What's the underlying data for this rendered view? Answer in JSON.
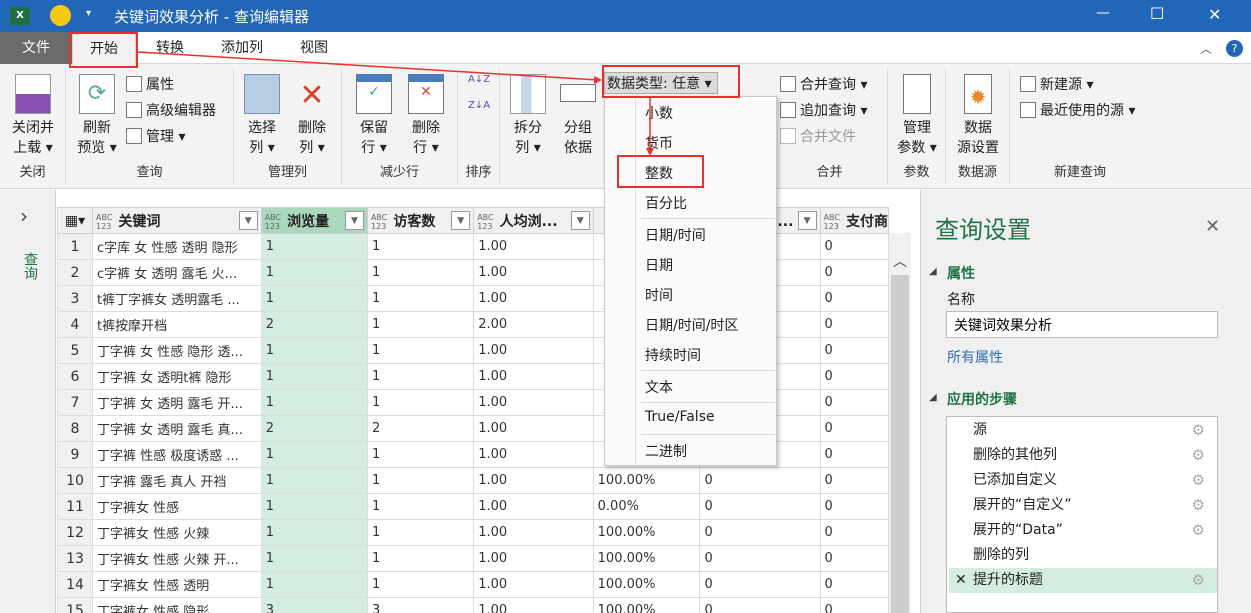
{
  "window": {
    "title": "关键词效果分析 - 查询编辑器",
    "app_icon": "excel-icon",
    "minimize": "—",
    "maximize": "☐",
    "close": "✕"
  },
  "tabs": [
    "文件",
    "开始",
    "转换",
    "添加列",
    "视图"
  ],
  "ribbon": {
    "close": {
      "label1": "关闭并",
      "label2": "上载 ▾",
      "group": "关闭"
    },
    "query": {
      "refresh1": "刷新",
      "refresh2": "预览 ▾",
      "properties": "属性",
      "advanced_editor": "高级编辑器",
      "manage": "管理 ▾",
      "group": "查询"
    },
    "manage_cols": {
      "choose1": "选择",
      "choose2": "列 ▾",
      "remove1": "删除",
      "remove2": "列 ▾",
      "group": "管理列"
    },
    "reduce_rows": {
      "keep1": "保留",
      "keep2": "行 ▾",
      "remove1": "删除",
      "remove2": "行 ▾",
      "group": "减少行"
    },
    "sort": {
      "group": "排序",
      "asc": "A↓Z",
      "desc": "Z↓A"
    },
    "transform": {
      "split1": "拆分",
      "split2": "列 ▾",
      "group1": "分组",
      "group2": "依据",
      "data_type": "数据类型: 任意 ▾"
    },
    "combine": {
      "merge": "合并查询 ▾",
      "append": "追加查询 ▾",
      "combine_files": "合并文件",
      "group": "合并"
    },
    "params": {
      "label1": "管理",
      "label2": "参数 ▾",
      "group": "参数"
    },
    "datasource": {
      "label1": "数据",
      "label2": "源设置",
      "group": "数据源"
    },
    "newquery": {
      "new_source": "新建源 ▾",
      "recent": "最近使用的源 ▾",
      "group": "新建查询"
    }
  },
  "leftpane": {
    "expand": "›",
    "label": "查询"
  },
  "grid": {
    "type_badge_top": "ABC",
    "type_badge_bottom": "123",
    "columns": [
      "关键词",
      "浏览量",
      "访客数",
      "人均浏...",
      "",
      "买...",
      "支付商"
    ],
    "rows": [
      [
        "1",
        "c字库 女 性感 透明 隐形",
        "1",
        "1",
        "1.00",
        "",
        "",
        "0"
      ],
      [
        "2",
        "c字裤 女 透明 露毛 火...",
        "1",
        "1",
        "1.00",
        "",
        "",
        "0"
      ],
      [
        "3",
        "t裤丁字裤女 透明露毛 ...",
        "1",
        "1",
        "1.00",
        "",
        "",
        "0"
      ],
      [
        "4",
        "t裤按摩开档",
        "2",
        "1",
        "2.00",
        "",
        "",
        "0"
      ],
      [
        "5",
        "丁字裤 女 性感 隐形 透...",
        "1",
        "1",
        "1.00",
        "",
        "",
        "0"
      ],
      [
        "6",
        "丁字裤 女 透明t裤 隐形",
        "1",
        "1",
        "1.00",
        "",
        "",
        "0"
      ],
      [
        "7",
        "丁字裤 女 透明 露毛 开...",
        "1",
        "1",
        "1.00",
        "",
        "",
        "0"
      ],
      [
        "8",
        "丁字裤 女 透明 露毛 真...",
        "2",
        "2",
        "1.00",
        "",
        "",
        "0"
      ],
      [
        "9",
        "丁字裤 性感 极度诱惑 ...",
        "1",
        "1",
        "1.00",
        "",
        "",
        "0"
      ],
      [
        "10",
        "丁字裤 露毛 真人 开裆",
        "1",
        "1",
        "1.00",
        "100.00%",
        "0",
        "0"
      ],
      [
        "11",
        "丁字裤女 性感",
        "1",
        "1",
        "1.00",
        "0.00%",
        "0",
        "0"
      ],
      [
        "12",
        "丁字裤女 性感 火辣",
        "1",
        "1",
        "1.00",
        "100.00%",
        "0",
        "0"
      ],
      [
        "13",
        "丁字裤女 性感 火辣 开...",
        "1",
        "1",
        "1.00",
        "100.00%",
        "0",
        "0"
      ],
      [
        "14",
        "丁字裤女 性感 透明",
        "1",
        "1",
        "1.00",
        "100.00%",
        "0",
        "0"
      ],
      [
        "15",
        "丁字裤女 性感 隐形",
        "3",
        "3",
        "1.00",
        "100.00%",
        "0",
        "0"
      ]
    ]
  },
  "type_menu": {
    "items": [
      "小数",
      "货币",
      "整数",
      "百分比",
      "日期/时间",
      "日期",
      "时间",
      "日期/时间/时区",
      "持续时间",
      "文本",
      "True/False",
      "二进制"
    ]
  },
  "settings": {
    "title": "查询设置",
    "close": "✕",
    "properties_header": "属性",
    "name_label": "名称",
    "name_value": "关键词效果分析",
    "all_properties": "所有属性",
    "steps_header": "应用的步骤",
    "steps": [
      "源",
      "删除的其他列",
      "已添加自定义",
      "展开的“自定义”",
      "展开的“Data”",
      "删除的列",
      "提升的标题"
    ],
    "active_step_marker": "✕"
  },
  "colors": {
    "title_blue": "#2266b8",
    "accent_green": "#217346",
    "highlight_red": "#e8312f",
    "selected_col": "#d4ede0"
  }
}
